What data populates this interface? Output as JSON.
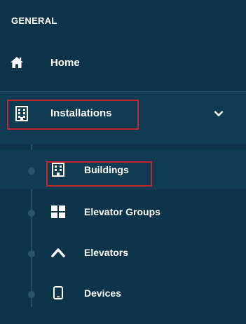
{
  "sidebar": {
    "section_title": "GENERAL",
    "items": [
      {
        "label": "Home",
        "icon": "home-icon"
      },
      {
        "label": "Installations",
        "icon": "building-icon",
        "expanded": true
      }
    ],
    "sub_items": [
      {
        "label": "Buildings",
        "icon": "building-icon",
        "active": true
      },
      {
        "label": "Elevator Groups",
        "icon": "grid-icon"
      },
      {
        "label": "Elevators",
        "icon": "chevron-up-icon"
      },
      {
        "label": "Devices",
        "icon": "tablet-icon"
      }
    ]
  },
  "colors": {
    "background": "#0d3448",
    "highlight_outline": "#c1272d",
    "text": "#ffffff"
  }
}
